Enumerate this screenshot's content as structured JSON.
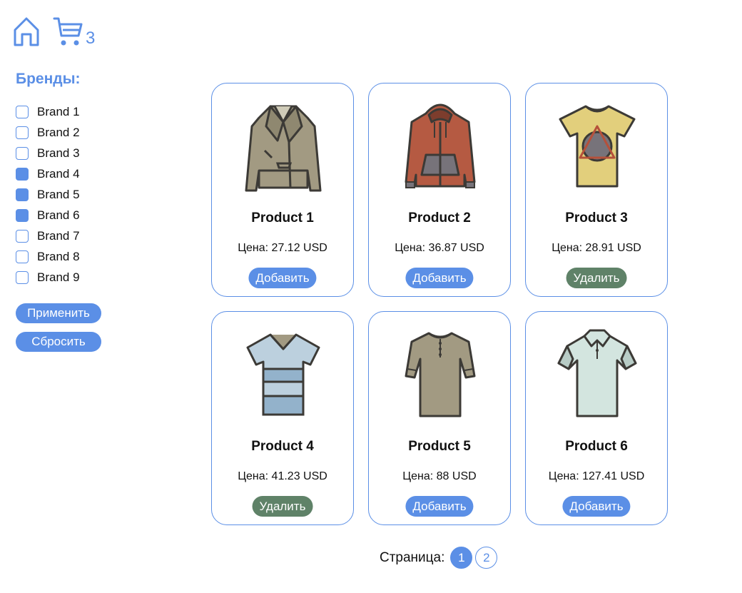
{
  "header": {
    "home_icon": "home-icon",
    "cart_icon": "cart-icon",
    "cart_count": "3"
  },
  "sidebar": {
    "title": "Бренды:",
    "brands": [
      {
        "label": "Brand 1",
        "checked": false
      },
      {
        "label": "Brand 2",
        "checked": false
      },
      {
        "label": "Brand 3",
        "checked": false
      },
      {
        "label": "Brand 4",
        "checked": true
      },
      {
        "label": "Brand 5",
        "checked": true
      },
      {
        "label": "Brand 6",
        "checked": true
      },
      {
        "label": "Brand 7",
        "checked": false
      },
      {
        "label": "Brand 8",
        "checked": false
      },
      {
        "label": "Brand 9",
        "checked": false
      }
    ],
    "apply_label": "Применить",
    "reset_label": "Сбросить"
  },
  "products": [
    {
      "title": "Product 1",
      "price": "Цена: 27.12 USD",
      "button": "Добавить",
      "in_cart": false,
      "icon": "leather-jacket-icon"
    },
    {
      "title": "Product 2",
      "price": "Цена: 36.87 USD",
      "button": "Добавить",
      "in_cart": false,
      "icon": "hoodie-icon"
    },
    {
      "title": "Product 3",
      "price": "Цена: 28.91 USD",
      "button": "Удалить",
      "in_cart": true,
      "icon": "triangle-tshirt-icon"
    },
    {
      "title": "Product 4",
      "price": "Цена: 41.23 USD",
      "button": "Удалить",
      "in_cart": true,
      "icon": "striped-tshirt-icon"
    },
    {
      "title": "Product 5",
      "price": "Цена: 88 USD",
      "button": "Добавить",
      "in_cart": false,
      "icon": "henley-shirt-icon"
    },
    {
      "title": "Product 6",
      "price": "Цена: 127.41 USD",
      "button": "Добавить",
      "in_cart": false,
      "icon": "polo-shirt-icon"
    }
  ],
  "pagination": {
    "label": "Страница:",
    "pages": [
      {
        "number": "1",
        "active": true
      },
      {
        "number": "2",
        "active": false
      }
    ]
  },
  "colors": {
    "accent": "#5b8fe6",
    "remove_button": "#5f8268",
    "text": "#111111"
  }
}
